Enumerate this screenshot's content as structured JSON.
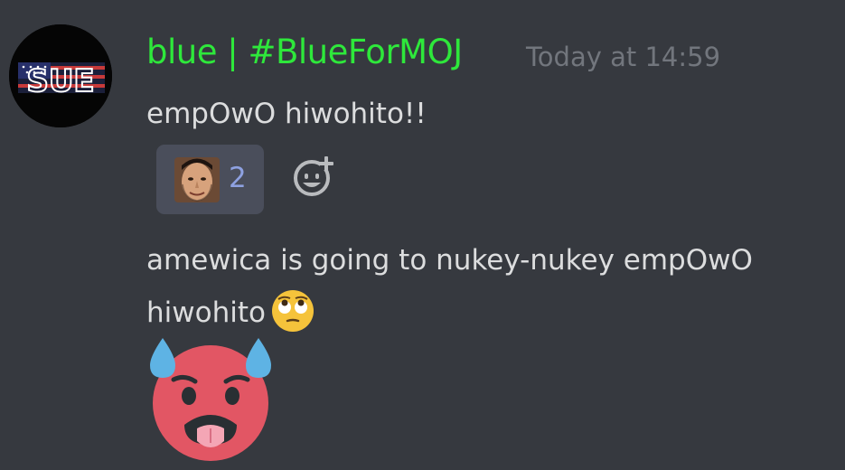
{
  "message": {
    "author": {
      "name": "blue | #BlueForMOJ",
      "name_color": "#2ee83b",
      "avatar_text": "SUE"
    },
    "timestamp": "Today at 14:59",
    "lines": {
      "first": "empOwO hiwohito!!",
      "second": "amewica is going to nukey-nukey empOwO hiwohito"
    },
    "reaction": {
      "emoji_icon": "custom-face-emoji",
      "count": "2"
    },
    "add_reaction_icon": "smiley-plus-icon",
    "inline_emoji_icon": "face-with-rolling-eyes-emoji",
    "jumbo_emoji_icon": "hot-sweating-face-emoji"
  },
  "colors": {
    "background": "#36393f",
    "text": "#dcddde",
    "timestamp": "#72767d",
    "reaction_bg": "#4a4e5b",
    "reaction_count": "#8ea1e1"
  }
}
